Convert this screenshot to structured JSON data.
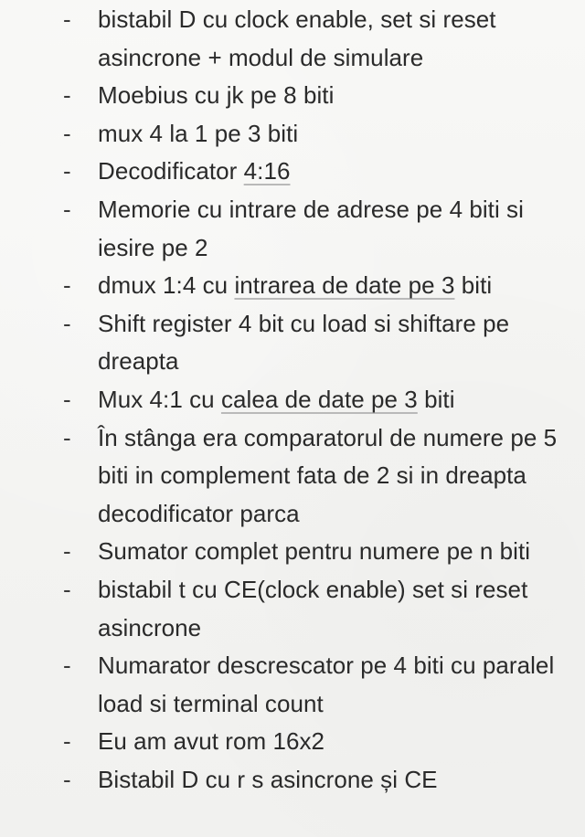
{
  "items": [
    {
      "segments": [
        {
          "text": "bistabil D cu clock enable, set si reset asincrone + modul de simulare"
        }
      ]
    },
    {
      "segments": [
        {
          "text": "Moebius cu jk pe 8 biti"
        }
      ]
    },
    {
      "segments": [
        {
          "text": "mux 4 la 1 pe 3 biti"
        }
      ]
    },
    {
      "segments": [
        {
          "text": "Decodificator "
        },
        {
          "text": "4:16",
          "underline": true
        }
      ]
    },
    {
      "segments": [
        {
          "text": "Memorie cu intrare de adrese pe 4 biti si iesire pe 2"
        }
      ]
    },
    {
      "segments": [
        {
          "text": "dmux 1:4 cu "
        },
        {
          "text": "intrarea de date pe 3",
          "underline": true
        },
        {
          "text": " biti"
        }
      ]
    },
    {
      "segments": [
        {
          "text": "Shift register 4 bit cu load si shiftare pe dreapta"
        }
      ]
    },
    {
      "segments": [
        {
          "text": "Mux 4:1 cu "
        },
        {
          "text": "calea de date pe 3",
          "underline": true
        },
        {
          "text": " biti"
        }
      ]
    },
    {
      "segments": [
        {
          "text": "În stânga era comparatorul de numere pe 5 biti in complement fata de 2 si in dreapta decodificator parca"
        }
      ]
    },
    {
      "segments": [
        {
          "text": "Sumator complet pentru numere pe n biti"
        }
      ]
    },
    {
      "segments": [
        {
          "text": "bistabil t cu CE(clock enable) set si reset asincrone"
        }
      ]
    },
    {
      "segments": [
        {
          "text": "Numarator descrescator pe 4 biti cu paralel load si terminal count"
        }
      ]
    },
    {
      "segments": [
        {
          "text": "Eu am avut rom 16x2"
        }
      ]
    },
    {
      "segments": [
        {
          "text": "Bistabil D cu r s asincrone și CE"
        }
      ]
    }
  ],
  "dash": "-",
  "colors": {
    "text": "#2a2a2a",
    "underline": "#b9b9b9",
    "background": "#f6f6f4"
  }
}
